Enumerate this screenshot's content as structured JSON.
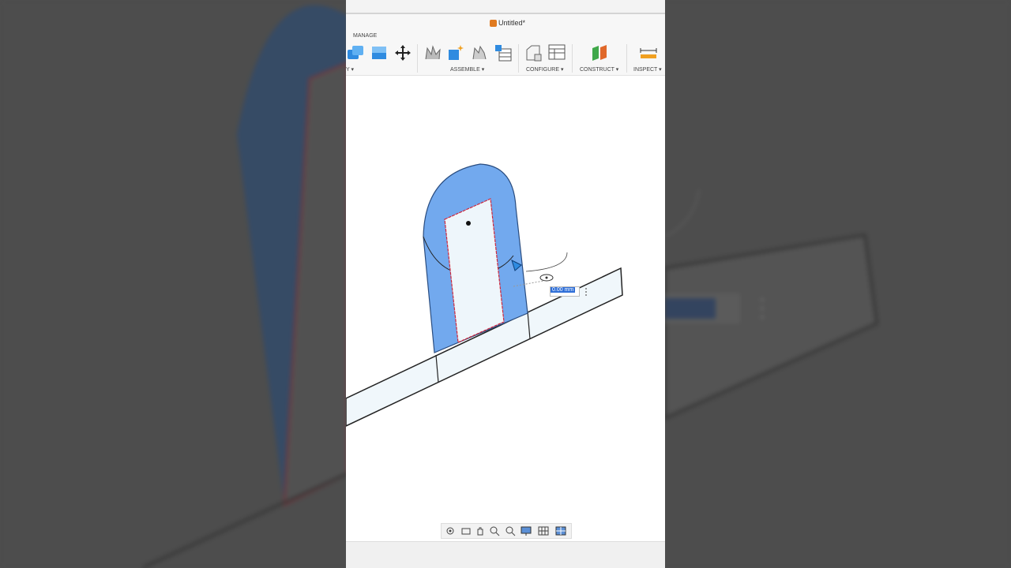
{
  "window": {
    "title": "Untitled*"
  },
  "toolbar": {
    "tab_manage": "MANAGE",
    "groups": {
      "modify_partial": "Y",
      "assemble": "ASSEMBLE",
      "configure": "CONFIGURE",
      "construct": "CONSTRUCT",
      "inspect": "INSPECT"
    }
  },
  "dimension": {
    "value": "0.00 mm"
  },
  "colors": {
    "accent": "#2f6fd8",
    "body_fill": "#6fa8ee",
    "face_fill": "#eef6fb",
    "edge_highlight": "#d0283c"
  },
  "icons": {
    "title": "cube-icon",
    "move": "move-arrows-icon",
    "navbar": [
      "orbit-icon",
      "look-at-icon",
      "pan-icon",
      "zoom-window-icon",
      "zoom-icon",
      "display-settings-icon",
      "grid-icon",
      "viewports-icon"
    ]
  }
}
